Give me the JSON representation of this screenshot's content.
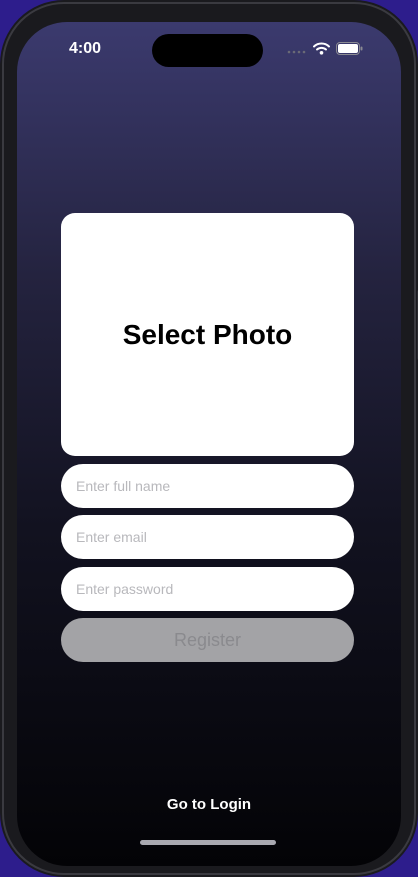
{
  "status_bar": {
    "time": "4:00",
    "icons": [
      "signal-dots-icon",
      "wifi-icon",
      "battery-icon"
    ]
  },
  "photo_picker": {
    "label": "Select Photo"
  },
  "form": {
    "full_name_placeholder": "Enter full name",
    "email_placeholder": "Enter email",
    "password_placeholder": "Enter password",
    "register_label": "Register"
  },
  "footer": {
    "go_to_login_label": "Go to Login"
  },
  "colors": {
    "background_top": "#3b3a6e",
    "background_bottom": "#030306",
    "register_disabled": "#a3a3a6",
    "outer_background": "#2d1d8c"
  }
}
